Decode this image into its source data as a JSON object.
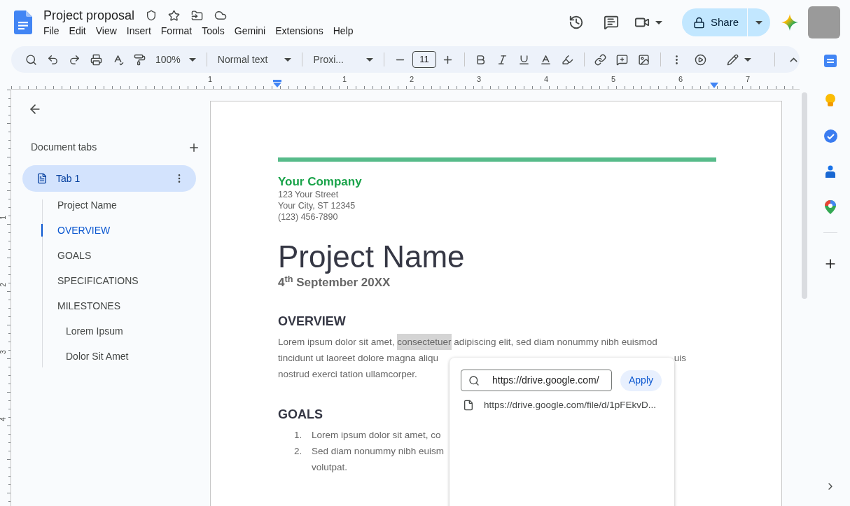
{
  "app": {
    "title": "Project proposal",
    "menus": [
      "File",
      "Edit",
      "View",
      "Insert",
      "Format",
      "Tools",
      "Gemini",
      "Extensions",
      "Help"
    ],
    "share": "Share"
  },
  "toolbar": {
    "zoom": "100%",
    "style": "Normal text",
    "font": "Proxi...",
    "font_size": "11"
  },
  "ruler": {
    "labels": [
      "1",
      "1",
      "2",
      "3",
      "4",
      "5",
      "6",
      "7"
    ]
  },
  "vertical_ruler": {
    "labels": [
      "1",
      "2",
      "3",
      "4"
    ]
  },
  "outline": {
    "heading": "Document tabs",
    "tab": {
      "label": "Tab 1",
      "selected": true
    },
    "items": [
      {
        "label": "Project Name",
        "selected": false
      },
      {
        "label": "OVERVIEW",
        "selected": true
      },
      {
        "label": "GOALS",
        "selected": false
      },
      {
        "label": "SPECIFICATIONS",
        "selected": false
      },
      {
        "label": "MILESTONES",
        "selected": false,
        "children": [
          {
            "label": "Lorem Ipsum",
            "selected": false
          },
          {
            "label": "Dolor Sit Amet",
            "selected": false
          }
        ]
      }
    ]
  },
  "document": {
    "company": {
      "name": "Your Company",
      "address_lines": [
        "123 Your Street",
        "Your City, ST 12345",
        "(123) 456-7890"
      ]
    },
    "title": "Project Name",
    "date": "4$^{th}$ September 20XX",
    "sections": [
      {
        "heading": "OVERVIEW",
        "kind": "paragraph",
        "lines": [
          [
            {
              "kind": "lead",
              "text": "Lorem ipsum dolor sit amet, ",
              "highlighted": false
            },
            {
              "kind": "lead",
              "text": "consectetuer",
              "highlighted": true
            },
            {
              "kind": "lead",
              "text": " adipiscing elit, sed diam nonummy nibh euismod",
              "highlighted": false
            }
          ],
          [
            {
              "kind": "lead",
              "text": "tincidunt ut laoreet dolore magna aliqu",
              "highlighted": false
            },
            {
              "kind": "tail",
              "text": "uis",
              "highlighted": false
            }
          ],
          [
            {
              "kind": "lead",
              "text": "nostrud exerci tation ullamcorper.",
              "highlighted": false
            }
          ]
        ]
      },
      {
        "heading": "GOALS",
        "kind": "list",
        "items": [
          {
            "number": "1.",
            "lines": [
              "Lorem ipsum dolor sit amet, co"
            ]
          },
          {
            "number": "2.",
            "lines": [
              "Sed diam nonummy nibh euism",
              "volutpat."
            ]
          }
        ]
      }
    ]
  },
  "link_popup": {
    "value": "https://drive.google.com/",
    "button": "Apply",
    "suggestions": [
      "https://drive.google.com/file/d/1pFEkvD..."
    ]
  }
}
